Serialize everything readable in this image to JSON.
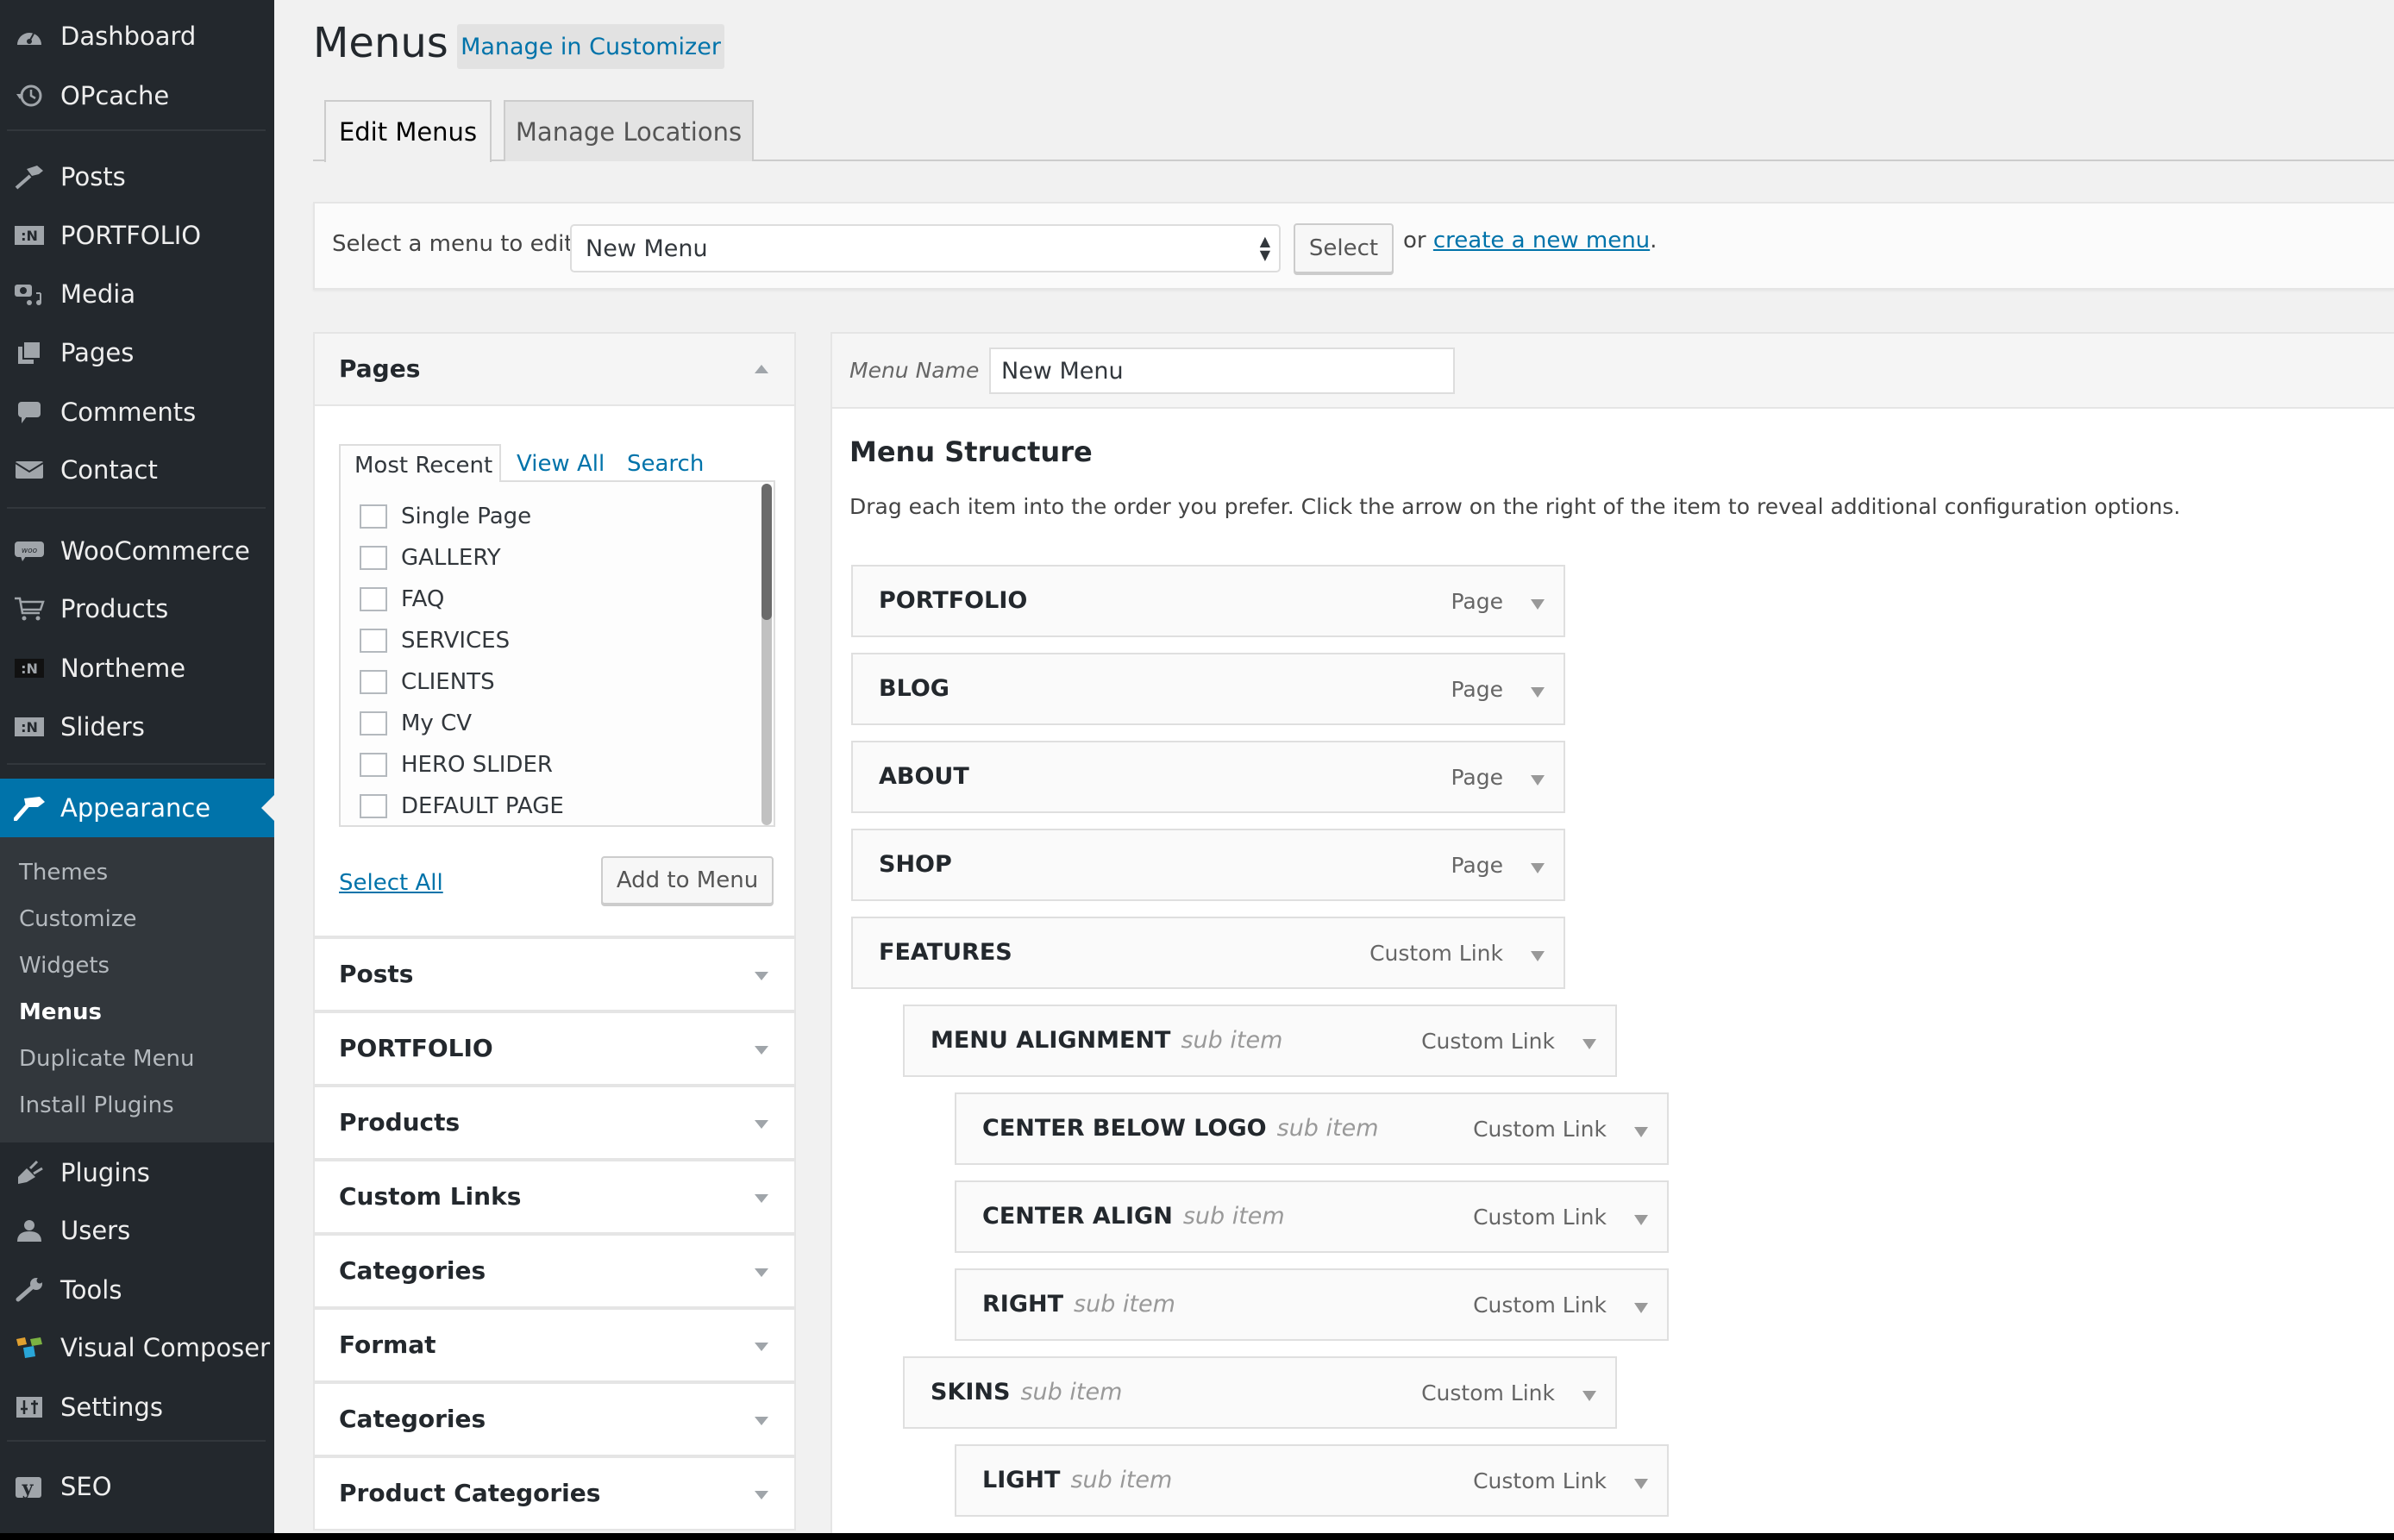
{
  "sidebar": {
    "items": [
      {
        "label": "Dashboard",
        "icon": "dashboard-icon"
      },
      {
        "label": "OPcache",
        "icon": "history-icon"
      },
      {
        "label": "Posts",
        "icon": "pushpin-icon"
      },
      {
        "label": "PORTFOLIO",
        "icon": "northeme-icon"
      },
      {
        "label": "Media",
        "icon": "media-icon"
      },
      {
        "label": "Pages",
        "icon": "pages-icon"
      },
      {
        "label": "Comments",
        "icon": "comment-icon"
      },
      {
        "label": "Contact",
        "icon": "envelope-icon"
      },
      {
        "label": "WooCommerce",
        "icon": "woo-icon"
      },
      {
        "label": "Products",
        "icon": "cart-icon"
      },
      {
        "label": "Northeme",
        "icon": "northeme-icon"
      },
      {
        "label": "Sliders",
        "icon": "northeme-icon"
      },
      {
        "label": "Appearance",
        "icon": "paintbrush-icon"
      },
      {
        "label": "Plugins",
        "icon": "plug-icon"
      },
      {
        "label": "Users",
        "icon": "user-icon"
      },
      {
        "label": "Tools",
        "icon": "wrench-icon"
      },
      {
        "label": "Visual Composer",
        "icon": "visual-composer-icon"
      },
      {
        "label": "Settings",
        "icon": "settings-icon"
      },
      {
        "label": "SEO",
        "icon": "yoast-icon"
      }
    ],
    "submenu": [
      "Themes",
      "Customize",
      "Widgets",
      "Menus",
      "Duplicate Menu",
      "Install Plugins"
    ],
    "active_item": "Appearance",
    "current_submenu": "Menus",
    "colors": {
      "background": "#23282d",
      "active": "#0073aa",
      "submenu": "#32373c"
    }
  },
  "header": {
    "title": "Menus",
    "customizer_button": "Manage in Customizer",
    "tabs": [
      {
        "label": "Edit Menus",
        "active": true
      },
      {
        "label": "Manage Locations",
        "active": false
      }
    ]
  },
  "select_bar": {
    "label": "Select a menu to edit:",
    "selected": "New Menu",
    "button": "Select",
    "or_text": "or",
    "create_link": "create a new menu",
    "period": "."
  },
  "pages_box": {
    "title": "Pages",
    "tabs": [
      "Most Recent",
      "View All",
      "Search"
    ],
    "items": [
      "Single Page",
      "GALLERY",
      "FAQ",
      "SERVICES",
      "CLIENTS",
      "My CV",
      "HERO SLIDER",
      "DEFAULT PAGE"
    ],
    "select_all": "Select All",
    "add_button": "Add to Menu"
  },
  "accordions": [
    "Posts",
    "PORTFOLIO",
    "Products",
    "Custom Links",
    "Categories",
    "Format",
    "Categories",
    "Product Categories"
  ],
  "menu_editor": {
    "name_label": "Menu Name",
    "name_value": "New Menu",
    "structure_title": "Menu Structure",
    "structure_desc": "Drag each item into the order you prefer. Click the arrow on the right of the item to reveal additional configuration options.",
    "sub_label": "sub item",
    "items": [
      {
        "title": "PORTFOLIO",
        "type": "Page",
        "depth": 0
      },
      {
        "title": "BLOG",
        "type": "Page",
        "depth": 0
      },
      {
        "title": "ABOUT",
        "type": "Page",
        "depth": 0
      },
      {
        "title": "SHOP",
        "type": "Page",
        "depth": 0
      },
      {
        "title": "FEATURES",
        "type": "Custom Link",
        "depth": 0
      },
      {
        "title": "MENU ALIGNMENT",
        "type": "Custom Link",
        "depth": 1
      },
      {
        "title": "CENTER BELOW LOGO",
        "type": "Custom Link",
        "depth": 2
      },
      {
        "title": "CENTER ALIGN",
        "type": "Custom Link",
        "depth": 2
      },
      {
        "title": "RIGHT",
        "type": "Custom Link",
        "depth": 2
      },
      {
        "title": "SKINS",
        "type": "Custom Link",
        "depth": 1
      },
      {
        "title": "LIGHT",
        "type": "Custom Link",
        "depth": 2
      }
    ]
  }
}
